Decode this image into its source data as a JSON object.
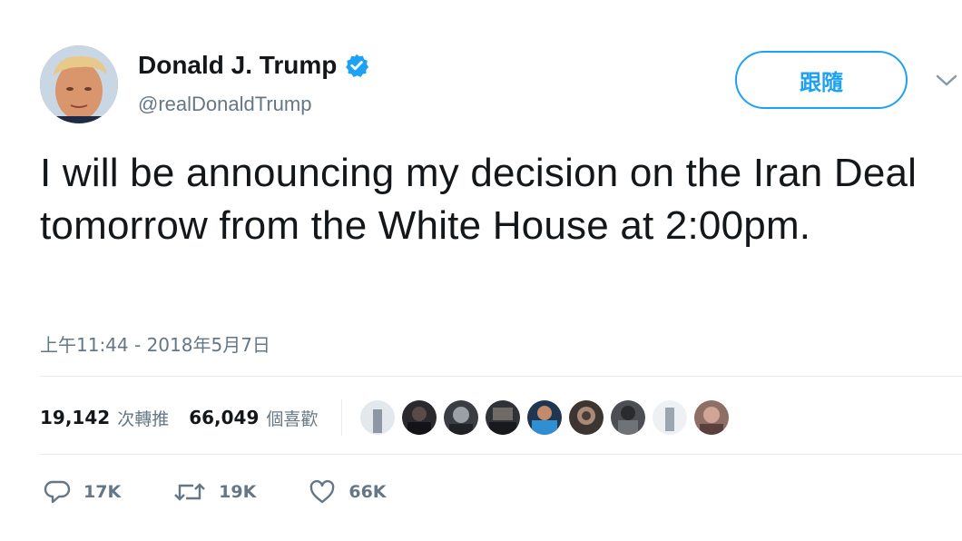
{
  "author": {
    "display_name": "Donald J. Trump",
    "handle": "@realDonaldTrump",
    "verified": true
  },
  "follow_button_label": "跟隨",
  "tweet": {
    "text": "I will be announcing my decision on the Iran Deal tomorrow from the White House at 2:00pm.",
    "timestamp": "上午11:44 - 2018年5月7日"
  },
  "stats": {
    "retweets_count": "19,142",
    "retweets_label": "次轉推",
    "likes_count": "66,049",
    "likes_label": "個喜歡"
  },
  "actions": {
    "reply_count": "17K",
    "retweet_count": "19K",
    "like_count": "66K"
  },
  "colors": {
    "accent": "#1da1f2",
    "secondary_text": "#657786",
    "primary_text": "#14171a",
    "divider": "#e6ecf0"
  },
  "icons": [
    "verified-icon",
    "chevron-down-icon",
    "reply-icon",
    "retweet-icon",
    "heart-icon"
  ]
}
